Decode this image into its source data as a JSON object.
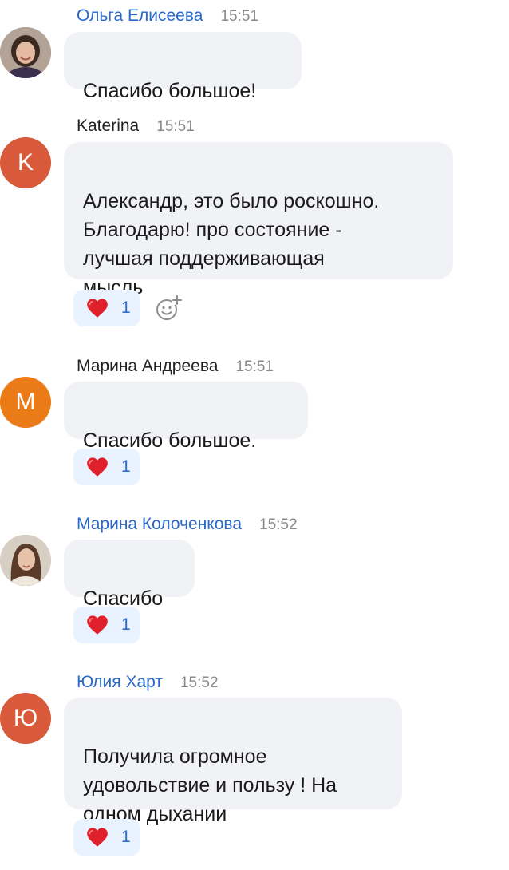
{
  "messages": [
    {
      "name": "Ольга Елисеева",
      "time": "15:51",
      "text": "Спасибо большое!",
      "avatar": {
        "type": "photo",
        "icon": "person-photo-icon"
      }
    },
    {
      "name": "Katerina",
      "time": "15:51",
      "text": "Александр, это было роскошно.\nБлагодарю! про состояние -\nлучшая поддерживающая\nмысль",
      "avatar": {
        "type": "initial",
        "letter": "K",
        "color": "#d85a3b"
      },
      "reaction": {
        "icon": "heart-icon",
        "count": "1"
      },
      "add_reaction_icon": "add-emoji-icon"
    },
    {
      "name": "Марина Андреева",
      "time": "15:51",
      "text": "Спасибо большое.",
      "avatar": {
        "type": "initial",
        "letter": "M",
        "color": "#ea7b17"
      },
      "reaction": {
        "icon": "heart-icon",
        "count": "1"
      }
    },
    {
      "name": "Марина Колоченкова",
      "time": "15:52",
      "text": "Спасибо",
      "avatar": {
        "type": "photo",
        "icon": "person-photo-icon"
      },
      "reaction": {
        "icon": "heart-icon",
        "count": "1"
      }
    },
    {
      "name": "Юлия Харт",
      "time": "15:52",
      "text": "Получила огромное\nудовольствие и пользу ! На\nодном дыхании",
      "avatar": {
        "type": "initial",
        "letter": "Ю",
        "color": "#d85a3b"
      },
      "reaction": {
        "icon": "heart-icon",
        "count": "1"
      }
    }
  ],
  "colors": {
    "link_name": "#2a68c9",
    "bubble_bg": "#f1f2f5",
    "reaction_bg": "#e9f2ff",
    "heart": "#e0202a"
  }
}
